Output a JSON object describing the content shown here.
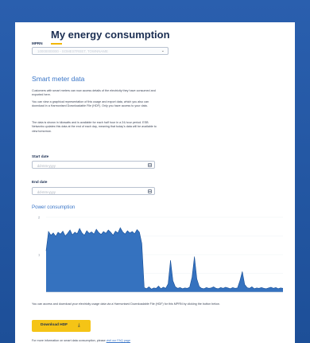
{
  "page": {
    "title": "My energy consumption"
  },
  "mprn": {
    "label": "MPRN",
    "value": "10000000000 - SOMESTREET, TOWNNAME"
  },
  "smart_meter": {
    "title": "Smart meter data",
    "paragraphs": [
      "Customers with smart meters can now access details of the electricity they have consumed and exported here.",
      "You can view a graphical representation of this usage and export data, which you also can download in a Harmonised Downloadable File (HDF). Only you have access to your data.",
      "The data is shown in kilowatts and is available for each half hour in a 24-hour period. ESB Networks updates this data at the end of each day, meaning that today's data will be available to view tomorrow."
    ]
  },
  "start_date": {
    "label": "Start date",
    "placeholder": "dd-mm-yyyy"
  },
  "end_date": {
    "label": "End date",
    "placeholder": "dd-mm-yyyy"
  },
  "chart": {
    "title": "Power consumption"
  },
  "chart_data": {
    "type": "area",
    "title": "Power consumption",
    "xlabel": "",
    "ylabel": "",
    "y_ticks": [
      "2",
      "1"
    ],
    "color": "#1f63b8",
    "values": [
      1.1,
      1.62,
      1.52,
      1.58,
      1.49,
      1.6,
      1.55,
      1.63,
      1.5,
      1.57,
      1.66,
      1.53,
      1.6,
      1.56,
      1.7,
      1.58,
      1.52,
      1.64,
      1.57,
      1.61,
      1.55,
      1.68,
      1.59,
      1.54,
      1.62,
      1.57,
      1.66,
      1.6,
      1.52,
      1.63,
      1.58,
      1.72,
      1.61,
      1.55,
      1.64,
      1.58,
      1.62,
      1.56,
      1.67,
      1.6,
      1.3,
      0.12,
      0.09,
      0.14,
      0.08,
      0.11,
      0.1,
      0.16,
      0.09,
      0.13,
      0.1,
      0.22,
      0.85,
      0.3,
      0.14,
      0.1,
      0.12,
      0.09,
      0.11,
      0.1,
      0.13,
      0.4,
      0.95,
      0.35,
      0.15,
      0.1,
      0.09,
      0.12,
      0.1,
      0.11,
      0.14,
      0.1,
      0.09,
      0.12,
      0.1,
      0.13,
      0.11,
      0.09,
      0.12,
      0.1,
      0.11,
      0.3,
      0.55,
      0.2,
      0.12,
      0.1,
      0.14,
      0.09,
      0.11,
      0.1,
      0.12,
      0.1,
      0.09,
      0.11,
      0.13,
      0.1,
      0.12,
      0.09,
      0.11,
      0.1
    ],
    "ylim": [
      0,
      2
    ]
  },
  "download": {
    "text": "You can access and download your electricity usage data via a Harmonised Downloadable File (HDF) for this MPRN by clicking the button below.",
    "button_label": "Download HDF",
    "button_icon": "download-icon"
  },
  "footer": {
    "text": "For more information on smart data consumption, please",
    "link": "visit our FAQ page"
  },
  "colors": {
    "accent": "#3a76c8",
    "button": "#f5c416",
    "background": "#1d4f98"
  }
}
